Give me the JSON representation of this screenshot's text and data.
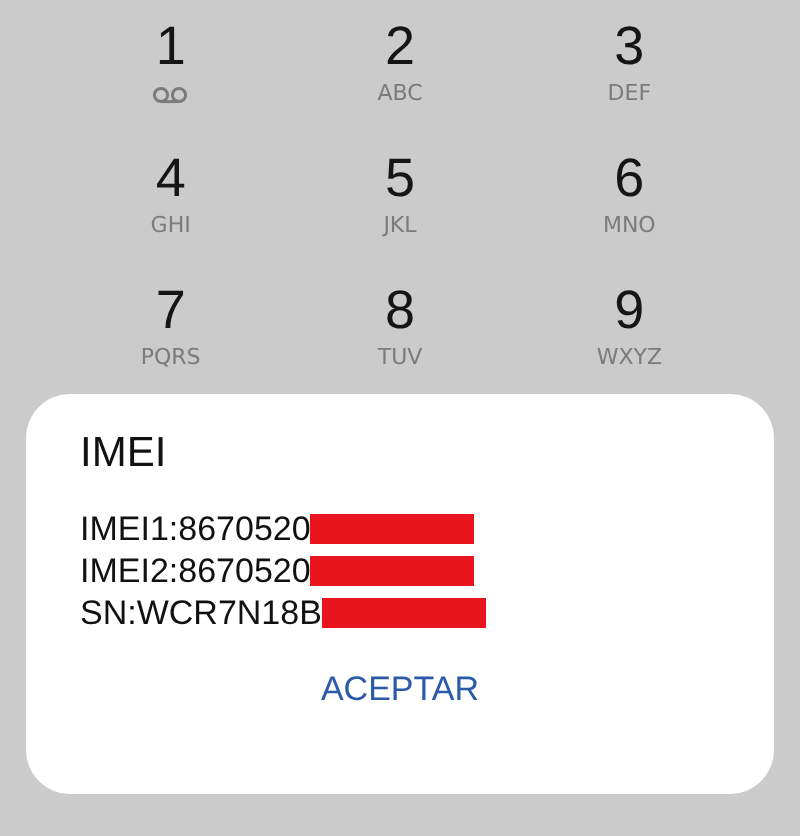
{
  "keypad": [
    {
      "digit": "1",
      "kind": "voicemail"
    },
    {
      "digit": "2",
      "letters": "ABC",
      "kind": "letters"
    },
    {
      "digit": "3",
      "letters": "DEF",
      "kind": "letters"
    },
    {
      "digit": "4",
      "letters": "GHI",
      "kind": "letters"
    },
    {
      "digit": "5",
      "letters": "JKL",
      "kind": "letters"
    },
    {
      "digit": "6",
      "letters": "MNO",
      "kind": "letters"
    },
    {
      "digit": "7",
      "letters": "PQRS",
      "kind": "letters"
    },
    {
      "digit": "8",
      "letters": "TUV",
      "kind": "letters"
    },
    {
      "digit": "9",
      "letters": "WXYZ",
      "kind": "letters"
    }
  ],
  "dialog": {
    "title": "IMEI",
    "lines": [
      {
        "text": "IMEI1:8670520",
        "redacted": true
      },
      {
        "text": "IMEI2:8670520",
        "redacted": true
      },
      {
        "text": "SN:WCR7N18B",
        "redacted": true
      }
    ],
    "button": "ACEPTAR"
  }
}
